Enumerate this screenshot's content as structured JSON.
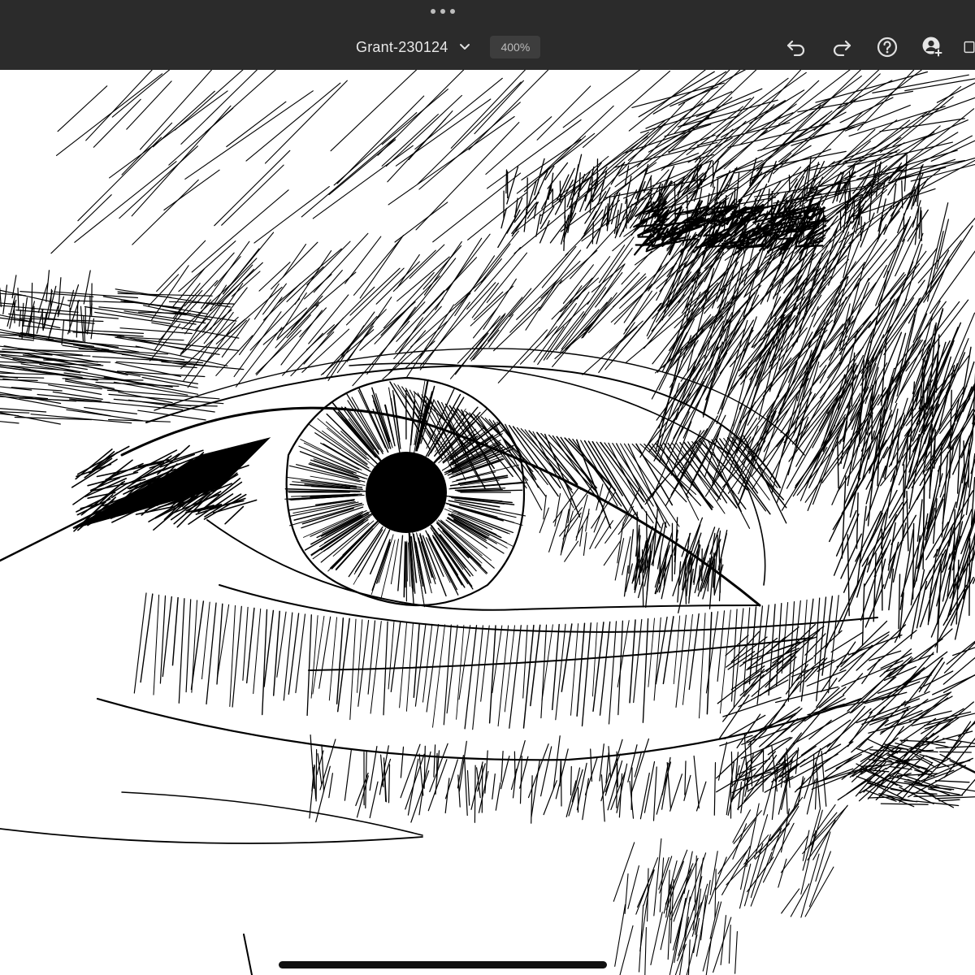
{
  "window": {
    "document_title": "Grant-230124",
    "zoom_level": "400%"
  },
  "toolbar": {
    "icons": [
      "undo-icon",
      "redo-icon",
      "help-icon",
      "user-add-icon",
      "layers-icon"
    ]
  },
  "canvas": {
    "artwork": "ink-hatched-eye-drawing",
    "background_color": "#ffffff",
    "ink_color": "#000000"
  },
  "colors": {
    "topbar": "#2b2b2b",
    "zoom_pill": "#3d3d3d"
  }
}
